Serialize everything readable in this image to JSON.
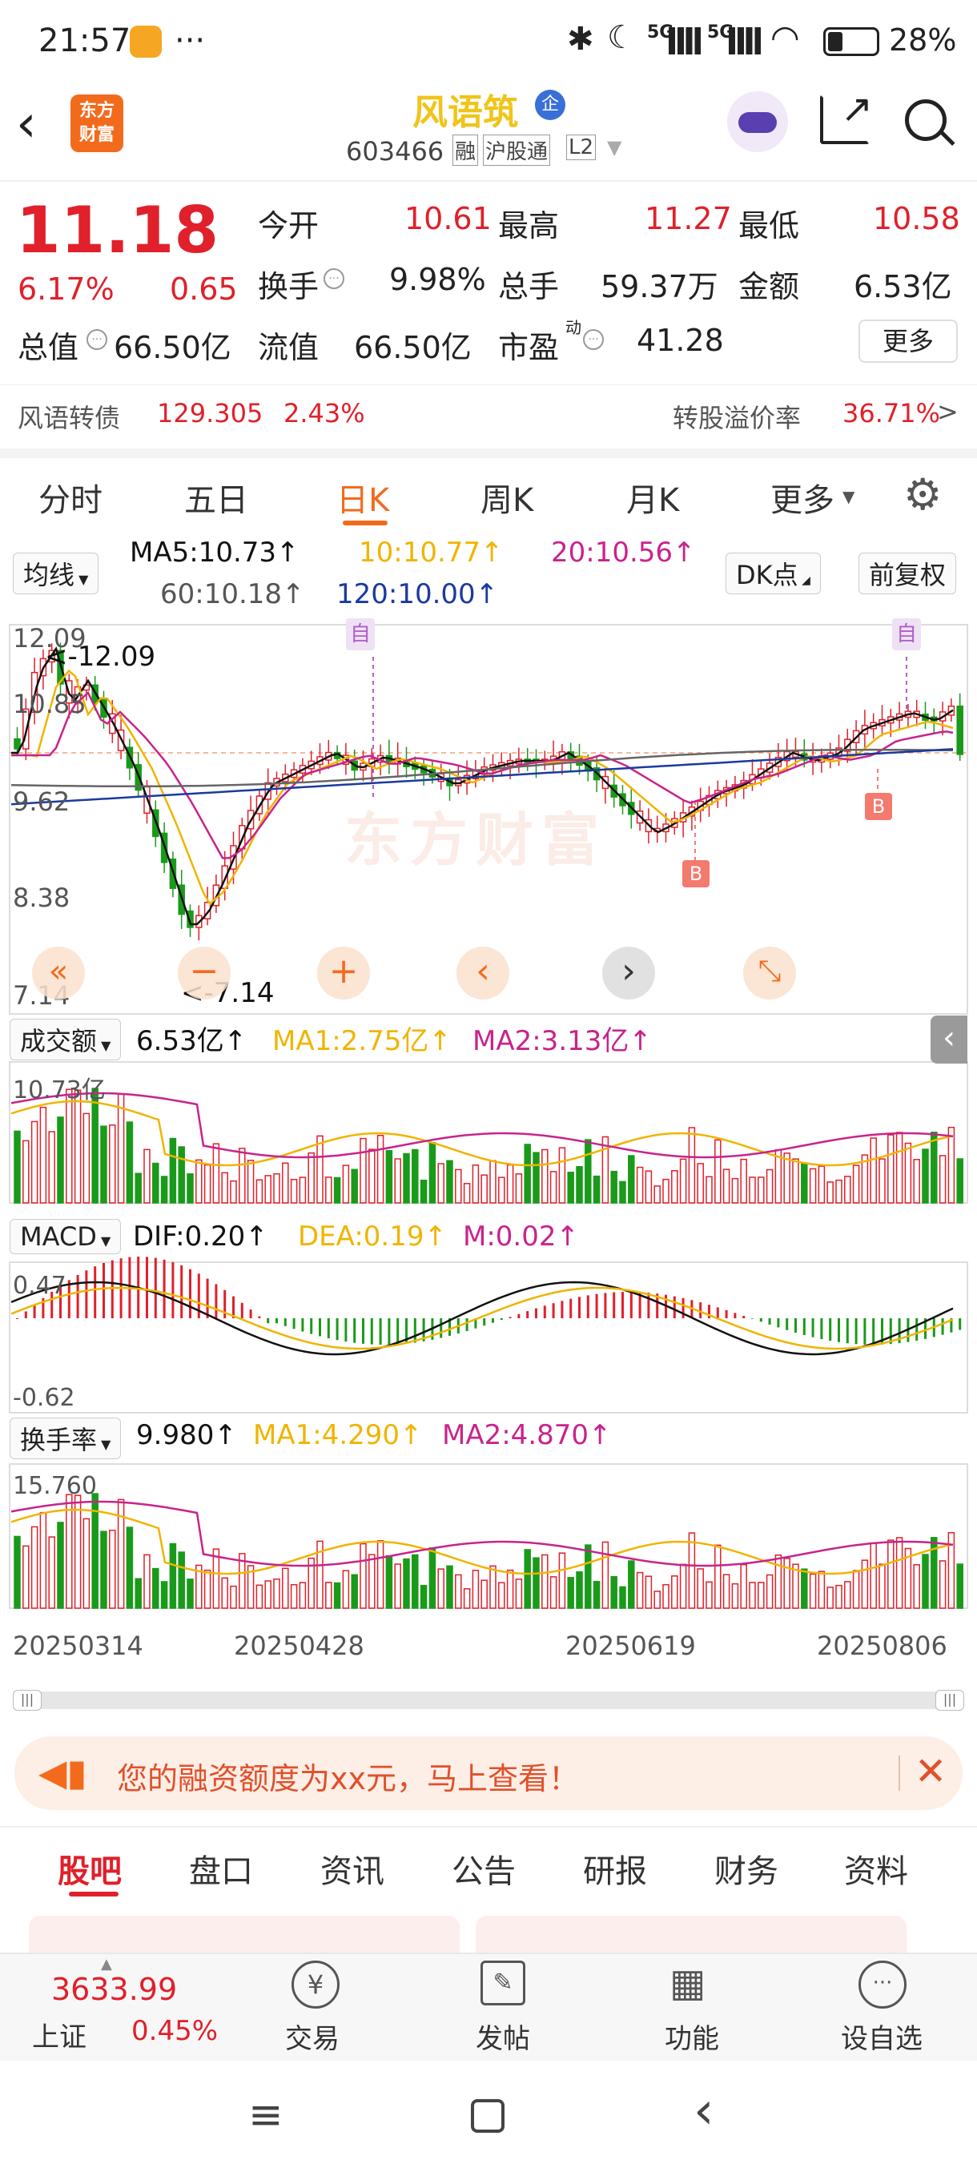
{
  "status": {
    "time": "21:57",
    "dots": "···",
    "battery": "28%",
    "sig1": "5G",
    "sig2": "5G"
  },
  "header": {
    "logo_line1": "东方",
    "logo_line2": "财富",
    "stock_name": "风语筑",
    "badge": "企",
    "code": "603466",
    "tag1": "融",
    "tag2": "沪股通",
    "tag3": "L2"
  },
  "quote": {
    "price": "11.18",
    "pct": "6.17%",
    "chg": "0.65",
    "open_label": "今开",
    "open": "10.61",
    "high_label": "最高",
    "high": "11.27",
    "low_label": "最低",
    "low": "10.58",
    "turn_label": "换手",
    "turn": "9.98%",
    "vol_label": "总手",
    "vol": "59.37万",
    "amt_label": "金额",
    "amt": "6.53亿",
    "cap_label": "总值",
    "cap": "66.50亿",
    "float_label": "流值",
    "float": "66.50亿",
    "pe_label": "市盈",
    "pe_sup": "动",
    "pe": "41.28",
    "more": "更多"
  },
  "bond": {
    "name": "风语转债",
    "price": "129.305",
    "pct": "2.43%",
    "premium_label": "转股溢价率",
    "premium": "36.71%",
    "arrow": ">"
  },
  "tabs": [
    "分时",
    "五日",
    "日K",
    "周K",
    "月K",
    "更多"
  ],
  "ma": {
    "selector": "均线",
    "ma5": "MA5:10.73↑",
    "ma10": "10:10.77↑",
    "ma20": "20:10.56↑",
    "ma60": "60:10.18↑",
    "ma120": "120:10.00↑",
    "dk": "DK点",
    "adj": "前复权"
  },
  "kline": {
    "y_max": "12.09",
    "y_2": "10.85",
    "y_3": "9.62",
    "y_4": "8.38",
    "y_min": "7.14",
    "hi_label": "<-12.09",
    "lo_label": "<-7.14",
    "zi1": "自",
    "zi2": "自",
    "b1": "B",
    "b2": "B",
    "watermark": "东方财富"
  },
  "volume": {
    "selector": "成交额",
    "val": "6.53亿↑",
    "ma1": "MA1:2.75亿↑",
    "ma2": "MA2:3.13亿↑",
    "ymax": "10.73亿"
  },
  "macd": {
    "selector": "MACD",
    "dif": "DIF:0.20↑",
    "dea": "DEA:0.19↑",
    "m": "M:0.02↑",
    "ymax": "0.47",
    "ymin": "-0.62"
  },
  "turnover": {
    "selector": "换手率",
    "val": "9.980↑",
    "ma1": "MA1:4.290↑",
    "ma2": "MA2:4.870↑",
    "ymax": "15.760"
  },
  "dates": [
    "20250314",
    "20250428",
    "20250619",
    "20250806"
  ],
  "banner": {
    "text": "您的融资额度为xx元，马上查看！"
  },
  "bottom_tabs": [
    "股吧",
    "盘口",
    "资讯",
    "公告",
    "研报",
    "财务",
    "资料"
  ],
  "bottom": {
    "index_val": "3633.99",
    "index_name": "上证",
    "index_pct": "0.45%",
    "b1": "交易",
    "b2": "发帖",
    "b3": "功能",
    "b4": "设自选"
  },
  "colors": {
    "up": "#e0202a",
    "down": "#1a9a1a",
    "accent": "#f26b1d",
    "ma5": "#111111",
    "ma10": "#f0b400",
    "ma20": "#c8238c",
    "ma60": "#666666",
    "ma120": "#1a3aa0"
  }
}
